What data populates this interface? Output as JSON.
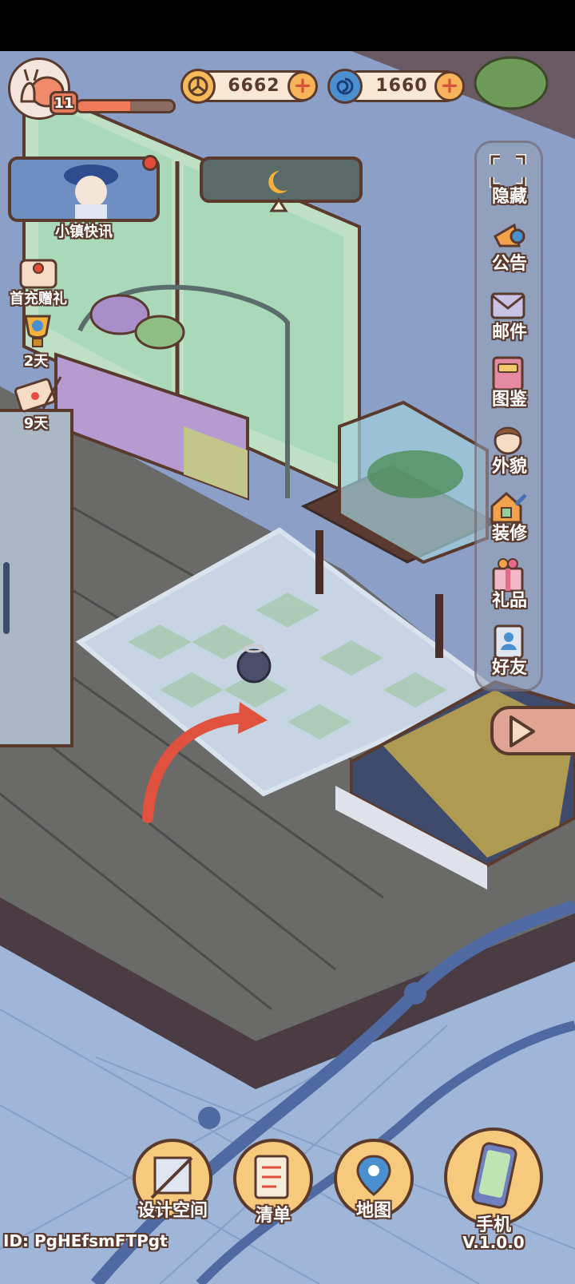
{
  "player": {
    "level": "11",
    "xp_fraction": 0.55
  },
  "currencies": [
    {
      "name": "coin",
      "value": "6662"
    },
    {
      "name": "swirl-gem",
      "value": "1660"
    }
  ],
  "left_menu": {
    "news_label": "小镇快讯",
    "first_recharge_label": "首充赠礼",
    "trophy_days": "2天",
    "letter_days": "9天"
  },
  "side_menu": [
    {
      "label": "隐藏",
      "icon": "hide-frame-icon"
    },
    {
      "label": "公告",
      "icon": "megaphone-icon"
    },
    {
      "label": "邮件",
      "icon": "mail-envelope-icon"
    },
    {
      "label": "图鉴",
      "icon": "album-book-icon"
    },
    {
      "label": "外貌",
      "icon": "character-face-icon"
    },
    {
      "label": "装修",
      "icon": "house-wrench-icon"
    },
    {
      "label": "礼品",
      "icon": "gift-box-icon"
    },
    {
      "label": "好友",
      "icon": "contact-book-icon"
    }
  ],
  "bottom_menu": [
    {
      "label": "设计空间",
      "icon": "design-ruler-icon"
    },
    {
      "label": "清单",
      "icon": "checklist-icon"
    },
    {
      "label": "地图",
      "icon": "map-pin-icon"
    },
    {
      "label": "手机",
      "icon": "phone-icon"
    }
  ],
  "version": "V.1.0.0",
  "player_id": "ID: PgHEfsmFTPgt",
  "colors": {
    "outline": "#5b3a2e",
    "accent_orange": "#f7b35a",
    "wall_blue": "#8aa0c8",
    "floor": "#6b6e6a"
  }
}
